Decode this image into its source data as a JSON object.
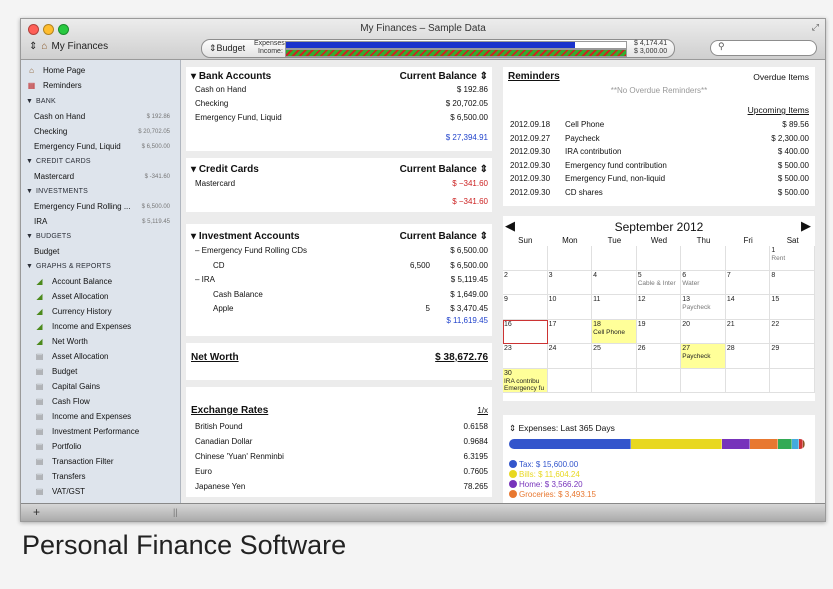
{
  "window": {
    "title": "My Finances – Sample Data"
  },
  "toolbar": {
    "account_selector": "My Finances",
    "budget_label": "Budget",
    "expenses_label": "Expenses:",
    "income_label": "Income:",
    "expenses_amount": "$ 4,174.41",
    "income_amount": "$ 3,000.00",
    "expenses_fraction": 0.85,
    "income_fraction": 1.0,
    "search_placeholder": ""
  },
  "sidebar": {
    "top": [
      {
        "label": "Home Page",
        "icon": "house-icon"
      },
      {
        "label": "Reminders",
        "icon": "calendar-icon"
      }
    ],
    "sections": [
      {
        "header": "BANK",
        "items": [
          {
            "label": "Cash on Hand",
            "amount": "$ 192.86"
          },
          {
            "label": "Checking",
            "amount": "$ 20,702.05"
          },
          {
            "label": "Emergency Fund, Liquid",
            "amount": "$ 6,500.00"
          }
        ]
      },
      {
        "header": "CREDIT CARDS",
        "items": [
          {
            "label": "Mastercard",
            "amount": "$ -341.60"
          }
        ]
      },
      {
        "header": "INVESTMENTS",
        "items": [
          {
            "label": "Emergency Fund Rolling ...",
            "amount": "$ 6,500.00"
          },
          {
            "label": "IRA",
            "amount": "$ 5,119.45"
          }
        ]
      },
      {
        "header": "BUDGETS",
        "items": [
          {
            "label": "Budget",
            "amount": ""
          }
        ]
      },
      {
        "header": "GRAPHS & REPORTS",
        "items": [
          {
            "label": "Account Balance",
            "icon": "graph-icon"
          },
          {
            "label": "Asset Allocation",
            "icon": "graph-icon"
          },
          {
            "label": "Currency History",
            "icon": "graph-icon"
          },
          {
            "label": "Income and Expenses",
            "icon": "graph-icon"
          },
          {
            "label": "Net Worth",
            "icon": "graph-icon"
          },
          {
            "label": "Asset Allocation",
            "icon": "report-icon"
          },
          {
            "label": "Budget",
            "icon": "report-icon"
          },
          {
            "label": "Capital Gains",
            "icon": "report-icon"
          },
          {
            "label": "Cash Flow",
            "icon": "report-icon"
          },
          {
            "label": "Income and Expenses",
            "icon": "report-icon"
          },
          {
            "label": "Investment Performance",
            "icon": "report-icon"
          },
          {
            "label": "Portfolio",
            "icon": "report-icon"
          },
          {
            "label": "Transaction Filter",
            "icon": "report-icon"
          },
          {
            "label": "Transfers",
            "icon": "report-icon"
          },
          {
            "label": "VAT/GST",
            "icon": "report-icon"
          }
        ]
      }
    ],
    "add_button": "+"
  },
  "bank": {
    "title": "Bank Accounts",
    "balance_header": "Current Balance",
    "rows": [
      {
        "name": "Cash on Hand",
        "value": "$ 192.86"
      },
      {
        "name": "Checking",
        "value": "$ 20,702.05"
      },
      {
        "name": "Emergency Fund, Liquid",
        "value": "$ 6,500.00"
      }
    ],
    "total": "$ 27,394.91"
  },
  "credit": {
    "title": "Credit Cards",
    "balance_header": "Current Balance",
    "rows": [
      {
        "name": "Mastercard",
        "value": "$ −341.60"
      }
    ],
    "total": "$ −341.60"
  },
  "investments": {
    "title": "Investment Accounts",
    "balance_header": "Current Balance",
    "rows": [
      {
        "name": "–  Emergency Fund Rolling CDs",
        "shares": "",
        "value": "$ 6,500.00"
      },
      {
        "name": "CD",
        "shares": "6,500",
        "value": "$ 6,500.00"
      },
      {
        "name": "–  IRA",
        "shares": "",
        "value": "$ 5,119.45"
      },
      {
        "name": "Cash Balance",
        "shares": "",
        "value": "$ 1,649.00"
      },
      {
        "name": "Apple",
        "shares": "5",
        "value": "$ 3,470.45"
      }
    ],
    "total": "$ 11,619.45"
  },
  "net_worth": {
    "label": "Net Worth",
    "value": "$ 38,672.76"
  },
  "exchange": {
    "title": "Exchange Rates",
    "unit": "1/x",
    "rows": [
      {
        "name": "British Pound",
        "value": "0.6158"
      },
      {
        "name": "Canadian Dollar",
        "value": "0.9684"
      },
      {
        "name": "Chinese 'Yuan' Renminbi",
        "value": "6.3195"
      },
      {
        "name": "Euro",
        "value": "0.7605"
      },
      {
        "name": "Japanese Yen",
        "value": "78.265"
      }
    ]
  },
  "reminders": {
    "title": "Reminders",
    "overdue_header": "Overdue Items",
    "no_overdue": "**No Overdue Reminders**",
    "upcoming_header": "Upcoming Items",
    "items": [
      {
        "date": "2012.09.18",
        "name": "Cell Phone",
        "value": "$ 89.56"
      },
      {
        "date": "2012.09.27",
        "name": "Paycheck",
        "value": "$ 2,300.00"
      },
      {
        "date": "2012.09.30",
        "name": "IRA contribution",
        "value": "$ 400.00"
      },
      {
        "date": "2012.09.30",
        "name": "Emergency fund contribution",
        "value": "$ 500.00"
      },
      {
        "date": "2012.09.30",
        "name": "Emergency Fund, non-liquid",
        "value": "$ 500.00"
      },
      {
        "date": "2012.09.30",
        "name": "CD shares",
        "value": "$ 500.00"
      }
    ]
  },
  "calendar": {
    "month": "September 2012",
    "prev": "◀",
    "next": "▶",
    "weekdays": [
      "Sun",
      "Mon",
      "Tue",
      "Wed",
      "Thu",
      "Fri",
      "Sat"
    ],
    "weeks": [
      [
        {
          "d": ""
        },
        {
          "d": ""
        },
        {
          "d": ""
        },
        {
          "d": ""
        },
        {
          "d": ""
        },
        {
          "d": ""
        },
        {
          "d": "1",
          "ev": "Rent"
        }
      ],
      [
        {
          "d": "2"
        },
        {
          "d": "3"
        },
        {
          "d": "4"
        },
        {
          "d": "5",
          "ev": "Cable & Inter"
        },
        {
          "d": "6",
          "ev": "Water"
        },
        {
          "d": "7"
        },
        {
          "d": "8"
        }
      ],
      [
        {
          "d": "9"
        },
        {
          "d": "10"
        },
        {
          "d": "11"
        },
        {
          "d": "12"
        },
        {
          "d": "13",
          "ev": "Paycheck"
        },
        {
          "d": "14"
        },
        {
          "d": "15"
        }
      ],
      [
        {
          "d": "16",
          "today": true
        },
        {
          "d": "17"
        },
        {
          "d": "18",
          "ev": "Cell Phone",
          "hl": true
        },
        {
          "d": "19"
        },
        {
          "d": "20"
        },
        {
          "d": "21"
        },
        {
          "d": "22"
        }
      ],
      [
        {
          "d": "23"
        },
        {
          "d": "24"
        },
        {
          "d": "25"
        },
        {
          "d": "26"
        },
        {
          "d": "27",
          "ev": "Paycheck",
          "hl": true
        },
        {
          "d": "28"
        },
        {
          "d": "29"
        }
      ],
      [
        {
          "d": "30",
          "ev": "IRA contribu Emergency fu",
          "hl": true
        },
        {
          "d": ""
        },
        {
          "d": ""
        },
        {
          "d": ""
        },
        {
          "d": ""
        },
        {
          "d": ""
        },
        {
          "d": ""
        }
      ]
    ]
  },
  "expenses": {
    "title": "Expenses: Last 365 Days",
    "legend": [
      {
        "label": "Tax: $ 15,600.00",
        "color": "#3355cc"
      },
      {
        "label": "Bills: $ 11,604.24",
        "color": "#e8d820"
      },
      {
        "label": "Home: $ 3,566.20",
        "color": "#7733bb"
      },
      {
        "label": "Groceries: $ 3,493.15",
        "color": "#e87830"
      }
    ],
    "segments": [
      {
        "color": "#3355cc",
        "value": 15600.0
      },
      {
        "color": "#e8d820",
        "value": 11604.24
      },
      {
        "color": "#7733bb",
        "value": 3566.2
      },
      {
        "color": "#e87830",
        "value": 3493.15
      },
      {
        "color": "#33aa55",
        "value": 1800
      },
      {
        "color": "#44aadd",
        "value": 900
      },
      {
        "color": "#cc3333",
        "value": 500
      },
      {
        "color": "#885522",
        "value": 300
      }
    ]
  },
  "caption": "Personal Finance Software",
  "colors": {
    "expenses_bar": "#1b33cc",
    "income_bar": "#2fae2f",
    "over_budget": "#cc2222",
    "link_blue": "#2244cc"
  }
}
